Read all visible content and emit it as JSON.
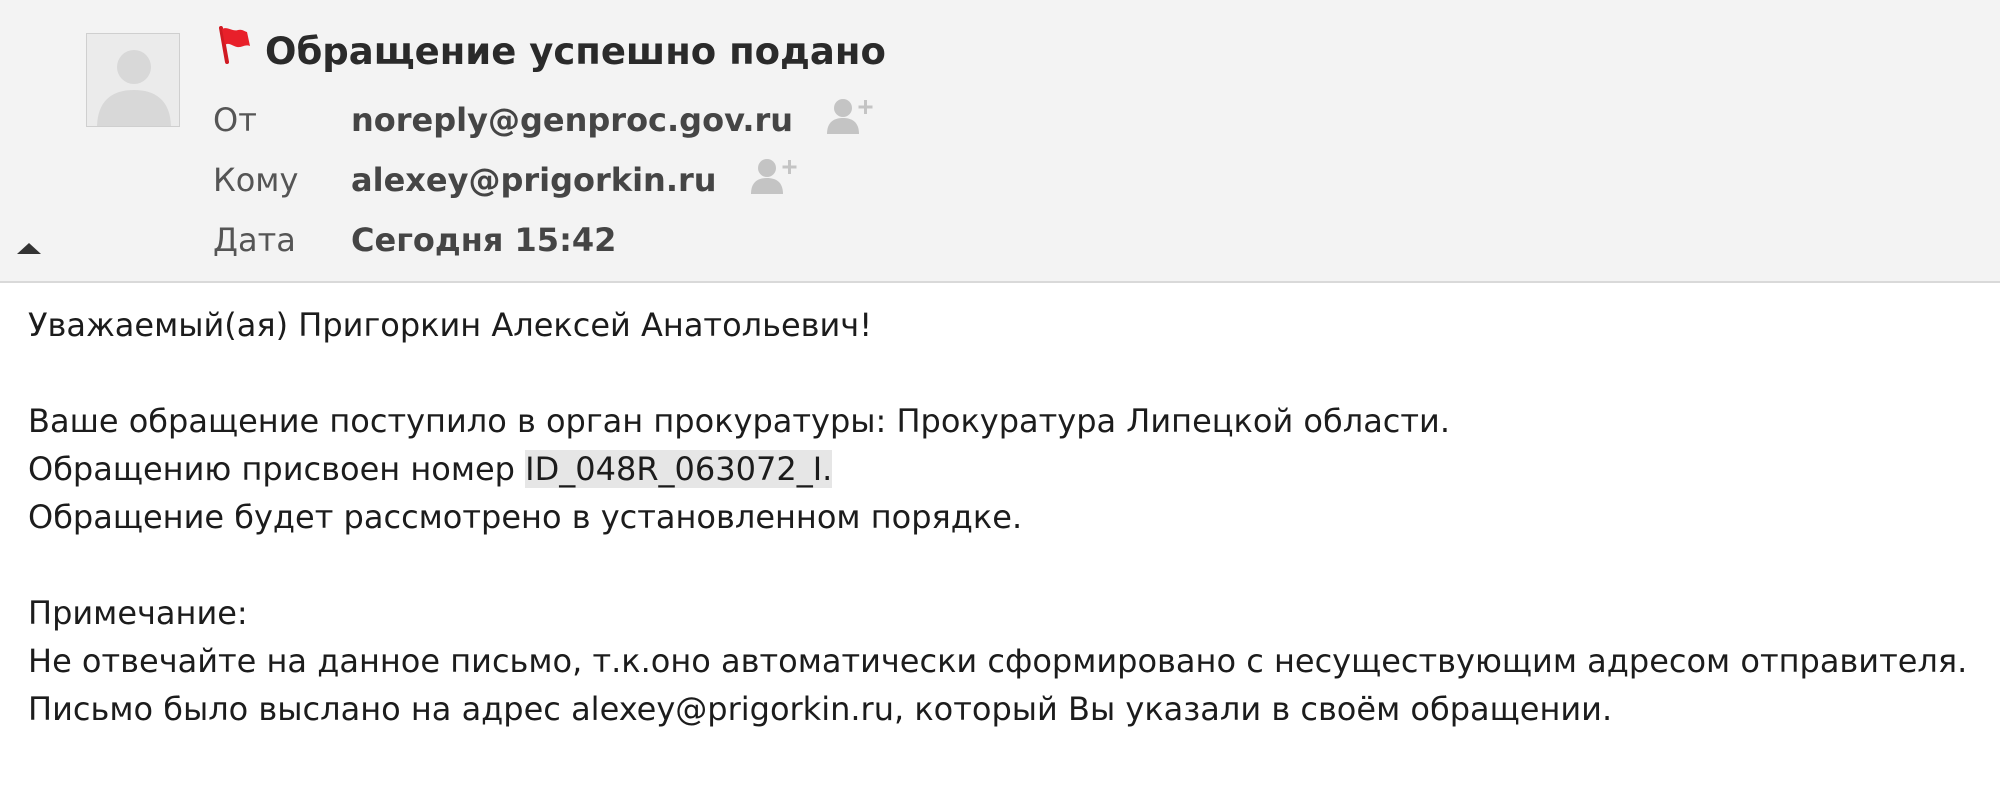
{
  "header": {
    "subject": "Обращение успешно подано",
    "from_label": "От",
    "from_value": "noreply@genproc.gov.ru",
    "to_label": "Кому",
    "to_value": "alexey@prigorkin.ru",
    "date_label": "Дата",
    "date_value": "Сегодня 15:42"
  },
  "icons": {
    "avatar": "avatar-placeholder-icon",
    "flag": "flag-icon",
    "add_contact": "add-contact-icon",
    "collapse": "collapse-triangle-icon"
  },
  "colors": {
    "flag": "#e8202a",
    "header_bg": "#f3f3f3",
    "highlight_bg": "#e6e6e6"
  },
  "body": {
    "greeting": "Уважаемый(ая) Пригоркин Алексей Анатольевич!",
    "line1": "Ваше обращение поступило в орган прокуратуры: Прокуратура Липецкой области.",
    "line2_prefix": "Обращению присвоен номер ",
    "line2_id": "ID_048R_063072_I.",
    "line3": "Обращение будет рассмотрено в установленном порядке.",
    "note_title": "Примечание:",
    "note1": "Не отвечайте на данное письмо, т.к.оно автоматически сформировано с несуществующим адресом отправителя.",
    "note2": "Письмо было выслано на адрес alexey@prigorkin.ru, который Вы указали в своём обращении."
  }
}
